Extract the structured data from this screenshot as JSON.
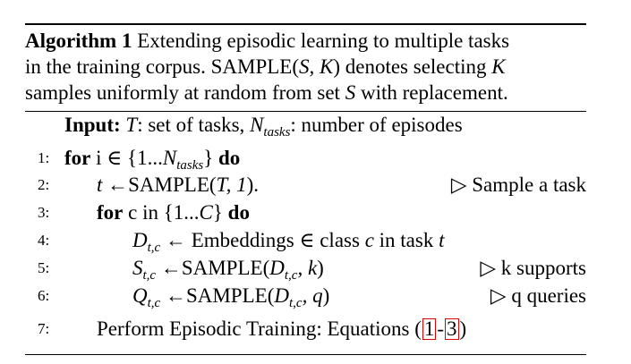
{
  "caption": {
    "label": "Algorithm 1",
    "line1": "Extending episodic learning to multiple tasks",
    "line2_a": "in the training corpus.  SAMPLE(",
    "line2_math": "S, K",
    "line2_b": ") denotes selecting ",
    "line2_k": "K",
    "line3_a": "samples uniformly at random from set ",
    "line3_s": "S",
    "line3_b": " with replacement."
  },
  "input": {
    "label": "Input:",
    "t": "T",
    "t_desc": ": set of tasks, ",
    "n": "N",
    "n_sub": "tasks",
    "n_desc": ": number of episodes"
  },
  "lines": [
    {
      "no": "1:",
      "kw1": "for",
      "text_a": " i ∈ {1...",
      "n": "N",
      "n_sub": "tasks",
      "text_b": "} ",
      "kw2": "do"
    },
    {
      "no": "2:",
      "var": "t",
      "text": " ←SAMPLE(",
      "arg": "T, 1",
      "text_end": ").",
      "comment": "▷ Sample a task"
    },
    {
      "no": "3:",
      "kw1": "for",
      "text_a": " c in {1...",
      "c": "C",
      "text_b": "} ",
      "kw2": "do"
    },
    {
      "no": "4:",
      "var": "D",
      "var_sub": "t,c",
      "text": " ← Embeddings ∈ class ",
      "c": "c",
      "text_b": " in task ",
      "t": "t"
    },
    {
      "no": "5:",
      "var": "S",
      "var_sub": "t,c",
      "text": " ←SAMPLE(",
      "arg": "D",
      "arg_sub": "t,c",
      "arg_rest": ", k",
      "text_end": ")",
      "comment": "▷ k supports"
    },
    {
      "no": "6:",
      "var": "Q",
      "var_sub": "t,c",
      "text": " ←SAMPLE(",
      "arg": "D",
      "arg_sub": "t,c",
      "arg_rest": ", q",
      "text_end": ")",
      "comment": "▷ q queries"
    },
    {
      "no": "7:",
      "text": "Perform Episodic Training: Equations (",
      "ref1": "1",
      "dash": "-",
      "ref2": "3",
      "text_end": ")"
    }
  ]
}
